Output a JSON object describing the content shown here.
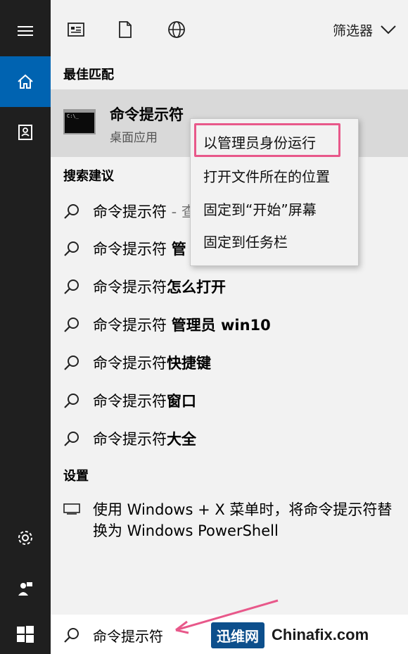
{
  "filter": {
    "label": "筛选器"
  },
  "sections": {
    "best_match": "最佳匹配",
    "suggestions": "搜索建议",
    "settings": "设置"
  },
  "best_match": {
    "name": "命令提示符",
    "type": "桌面应用",
    "icon_text": "C:\\_"
  },
  "context_menu": [
    "以管理员身份运行",
    "打开文件所在的位置",
    "固定到“开始”屏幕",
    "固定到任务栏"
  ],
  "suggestions": [
    {
      "normal": "命令提示符",
      "bold": "",
      "extra": " - 查"
    },
    {
      "normal": "命令提示符 ",
      "bold": "管",
      "extra": ""
    },
    {
      "normal": "命令提示符",
      "bold": "怎么打开",
      "extra": ""
    },
    {
      "normal": "命令提示符 ",
      "bold": "管理员 win10",
      "extra": ""
    },
    {
      "normal": "命令提示符",
      "bold": "快捷键",
      "extra": ""
    },
    {
      "normal": "命令提示符",
      "bold": "窗口",
      "extra": ""
    },
    {
      "normal": "命令提示符",
      "bold": "大全",
      "extra": ""
    }
  ],
  "setting_item": "使用 Windows + X 菜单时，将命令提示符替换为 Windows PowerShell",
  "search": {
    "value": "命令提示符"
  },
  "watermark": {
    "badge": "迅维网",
    "site": "Chinafix.com"
  },
  "colors": {
    "accent": "#0063b1",
    "highlight_border": "#e8588a",
    "rail": "#1f1f1f"
  }
}
